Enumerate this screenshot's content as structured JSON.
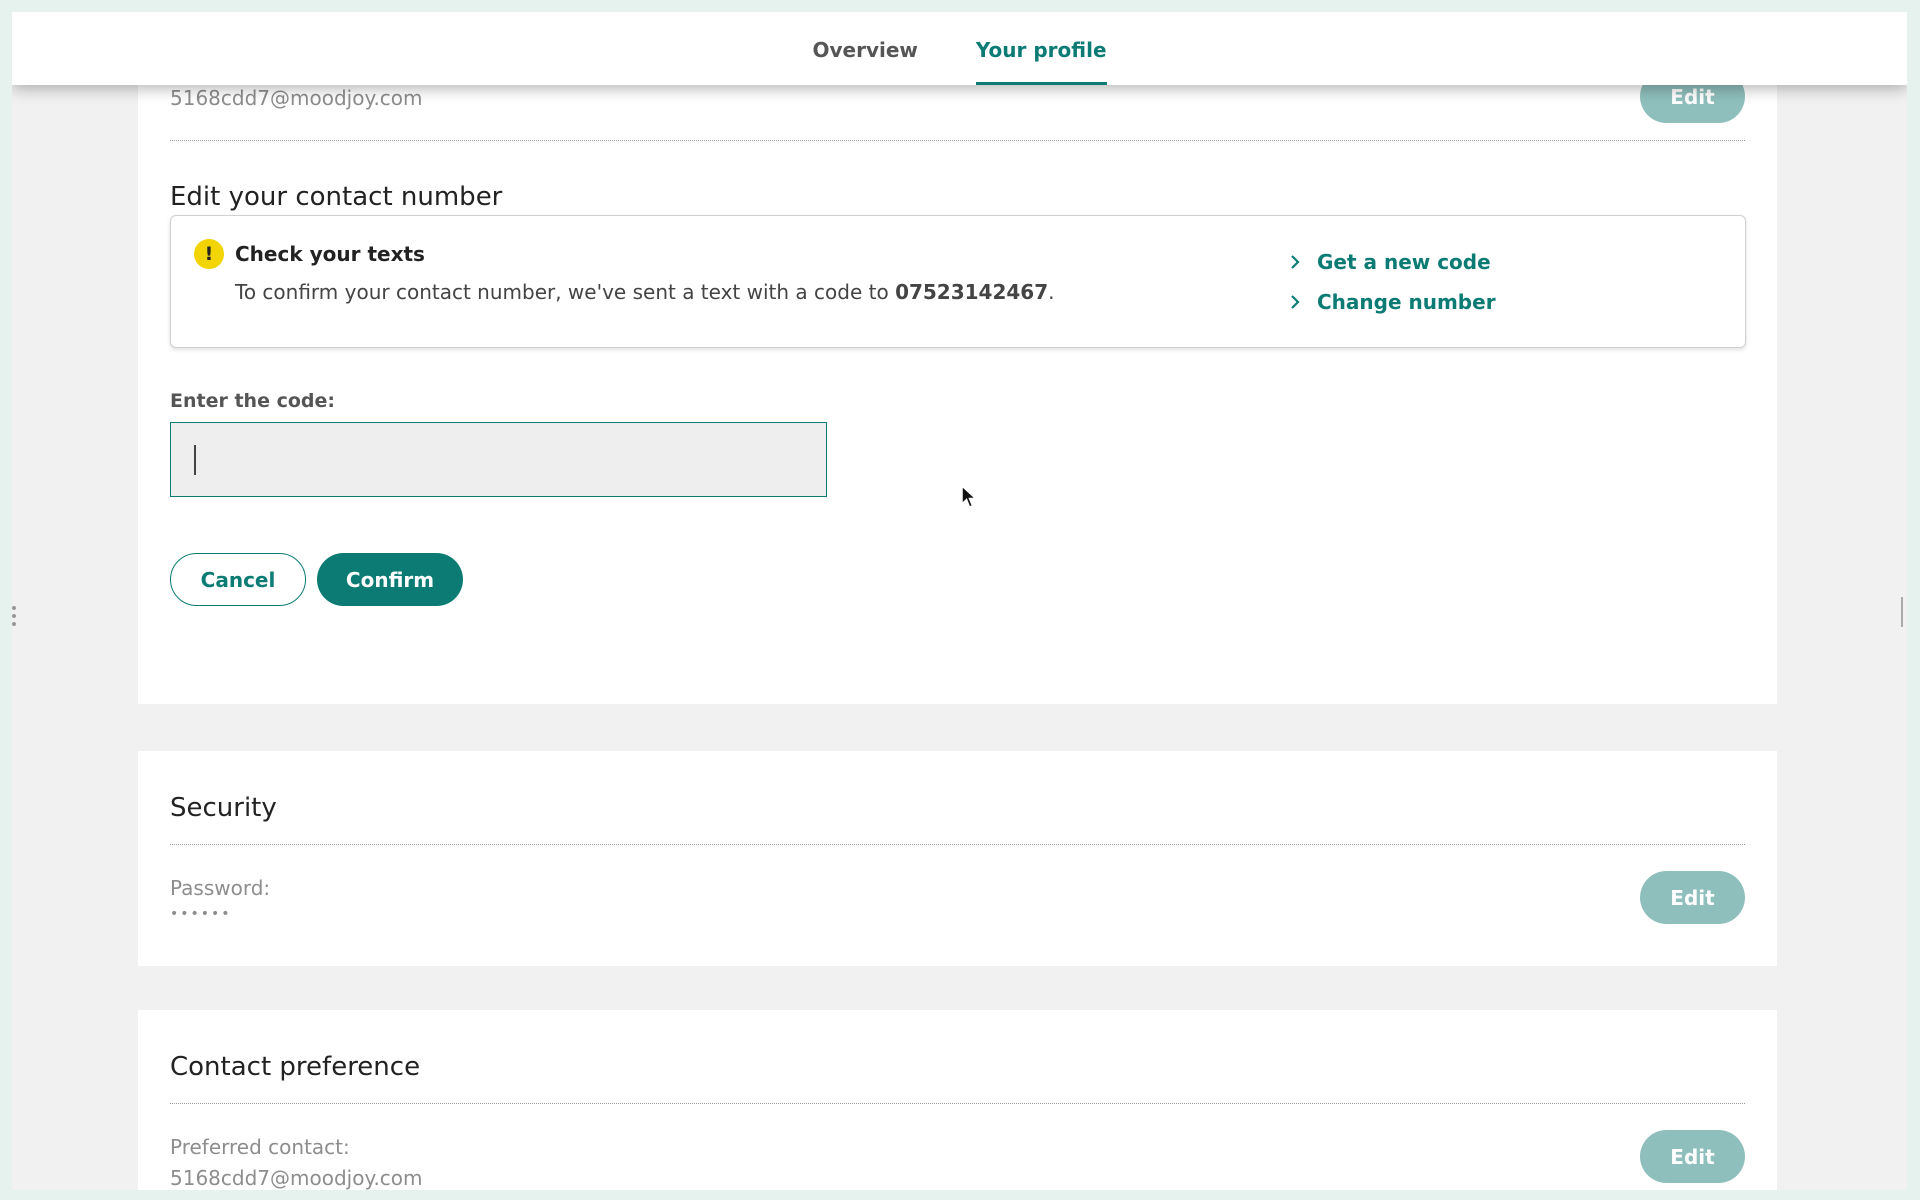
{
  "nav": {
    "tabs": [
      {
        "label": "Overview",
        "active": false
      },
      {
        "label": "Your profile",
        "active": true
      }
    ]
  },
  "email_section": {
    "email_value": "5168cdd7@moodjoy.com",
    "edit_label": "Edit"
  },
  "contact": {
    "heading": "Edit your contact number",
    "alert": {
      "icon": "exclamation-icon",
      "title": "Check your texts",
      "body_prefix": "To confirm your contact number, we've sent a text with a code to ",
      "phone": "07523142467",
      "body_suffix": ".",
      "links": [
        "Get a new code",
        "Change number"
      ]
    },
    "code_label": "Enter the code:",
    "code_value": "",
    "cancel_label": "Cancel",
    "confirm_label": "Confirm"
  },
  "security": {
    "heading": "Security",
    "password_label": "Password:",
    "password_value": "••••••",
    "edit_label": "Edit"
  },
  "preference": {
    "heading": "Contact preference",
    "label": "Preferred contact:",
    "value": "5168cdd7@moodjoy.com",
    "edit_label": "Edit"
  },
  "colors": {
    "accent": "#0b7b74",
    "edit_button": "#8fbfbc",
    "alert_icon": "#f2d400",
    "page_bg": "#f1f1f1"
  }
}
